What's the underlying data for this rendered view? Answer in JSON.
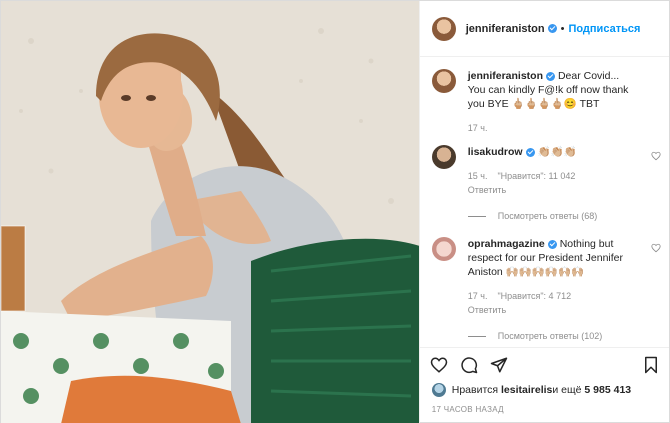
{
  "header": {
    "username": "jenniferaniston",
    "follow_label": "Подписаться"
  },
  "caption": {
    "username": "jenniferaniston",
    "text": "Dear Covid... You can kindly F@!k off now thank you BYE 🖕🏼🖕🏼🖕🏼🖕🏼😊 TBT",
    "time": "17 ч."
  },
  "comments": [
    {
      "username": "lisakudrow",
      "text": "👏🏼👏🏼👏🏼",
      "time": "15 ч.",
      "likes": "\"Нравится\": 11 042",
      "reply": "Ответить",
      "view_replies": "Посмотреть ответы (68)"
    },
    {
      "username": "oprahmagazine",
      "text": "Nothing but respect for our President Jennifer Aniston 🙌🏼🙌🏼🙌🏼🙌🏼🙌🏼🙌🏼",
      "time": "17 ч.",
      "likes": "\"Нравится\": 4 712",
      "reply": "Ответить",
      "view_replies": "Посмотреть ответы (102)"
    }
  ],
  "likes_line": {
    "prefix": "Нравится ",
    "user": "lesitairelis",
    "middle": " и ещё ",
    "count": "5 985 413"
  },
  "timestamp": "17 часов назад",
  "icons": [
    "heart-icon",
    "comment-icon",
    "share-icon",
    "bookmark-icon"
  ]
}
